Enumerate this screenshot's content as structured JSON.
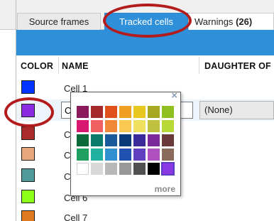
{
  "tabs": {
    "source_frames": "Source frames",
    "tracked_cells": "Tracked cells",
    "warnings_label": "Warnings",
    "warnings_count": "(26)"
  },
  "table": {
    "headers": {
      "color": "COLOR",
      "name": "NAME",
      "daughter_of": "DAUGHTER OF"
    },
    "rows": [
      {
        "name": "Cell 1",
        "color": "#0033ff"
      },
      {
        "name": "C",
        "color": "#8a2be2",
        "daughter_of": "(None)",
        "editing": true
      },
      {
        "name": "C",
        "color": "#a82a2a"
      },
      {
        "name": "C",
        "color": "#e8a77c"
      },
      {
        "name": "C",
        "color": "#4f9a9a"
      },
      {
        "name": "Cell 6",
        "color": "#8cff1a"
      },
      {
        "name": "Cell 7",
        "color": "#e07a20"
      }
    ]
  },
  "color_picker": {
    "close_icon": "×",
    "more_label": "more",
    "swatches": [
      [
        "#8b1a5c",
        "#a52a2a",
        "#e0501a",
        "#f0a020",
        "#e8c820",
        "#a8a820",
        "#90c020"
      ],
      [
        "#d81870",
        "#f06060",
        "#f08838",
        "#f8c850",
        "#f0e060",
        "#c0c040",
        "#b8d838"
      ],
      [
        "#0a6a3a",
        "#0a7a6a",
        "#1a5a9a",
        "#0a3a7a",
        "#3a2a9a",
        "#7a2a9a",
        "#6a3a3a"
      ],
      [
        "#20a060",
        "#20b0a0",
        "#3090d0",
        "#2050b0",
        "#6040c0",
        "#b050c0",
        "#8a6a5a"
      ],
      [
        "#ffffff",
        "#d8d8d8",
        "#b8b8b8",
        "#989898",
        "#505050",
        "#000000",
        "#8a3ae2"
      ]
    ]
  }
}
